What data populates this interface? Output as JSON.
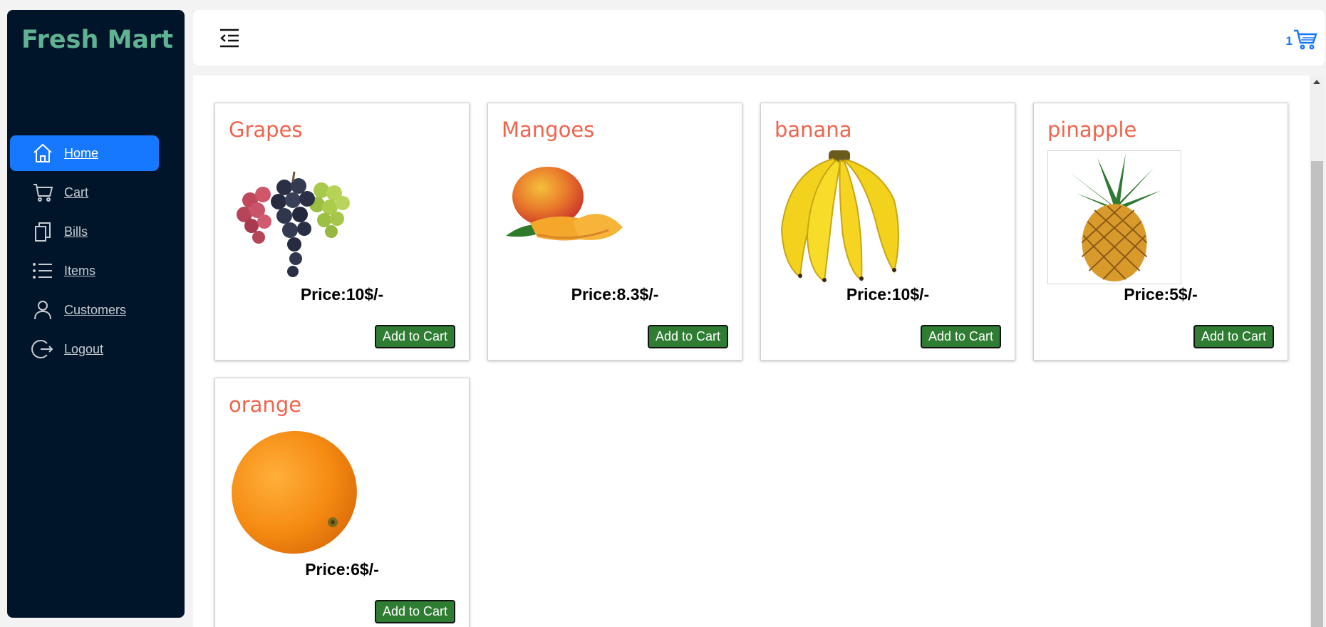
{
  "app": {
    "brand": "Fresh Mart"
  },
  "sidebar": {
    "items": [
      {
        "label": "Home",
        "icon": "home-icon",
        "active": true
      },
      {
        "label": "Cart",
        "icon": "cart-icon",
        "active": false
      },
      {
        "label": "Bills",
        "icon": "copy-icon",
        "active": false
      },
      {
        "label": "Items",
        "icon": "list-icon",
        "active": false
      },
      {
        "label": "Customers",
        "icon": "user-icon",
        "active": false
      },
      {
        "label": "Logout",
        "icon": "logout-icon",
        "active": false
      }
    ]
  },
  "header": {
    "toggle_icon": "menu-fold-icon",
    "cart_count": "1",
    "cart_icon": "shopping-cart-icon"
  },
  "products": [
    {
      "name": "Grapes",
      "price": "Price:10$/-",
      "button": "Add to Cart",
      "image": "grapes"
    },
    {
      "name": "Mangoes",
      "price": "Price:8.3$/-",
      "button": "Add to Cart",
      "image": "mango"
    },
    {
      "name": "banana",
      "price": "Price:10$/-",
      "button": "Add to Cart",
      "image": "banana"
    },
    {
      "name": "pinapple",
      "price": "Price:5$/-",
      "button": "Add to Cart",
      "image": "pineapple"
    },
    {
      "name": "orange",
      "price": "Price:6$/-",
      "button": "Add to Cart",
      "image": "orange"
    }
  ],
  "colors": {
    "sidebar_bg": "#001529",
    "brand": "#5fb393",
    "accent": "#1677ff",
    "product_title": "#f0644c",
    "button_bg": "#2e7d32"
  }
}
